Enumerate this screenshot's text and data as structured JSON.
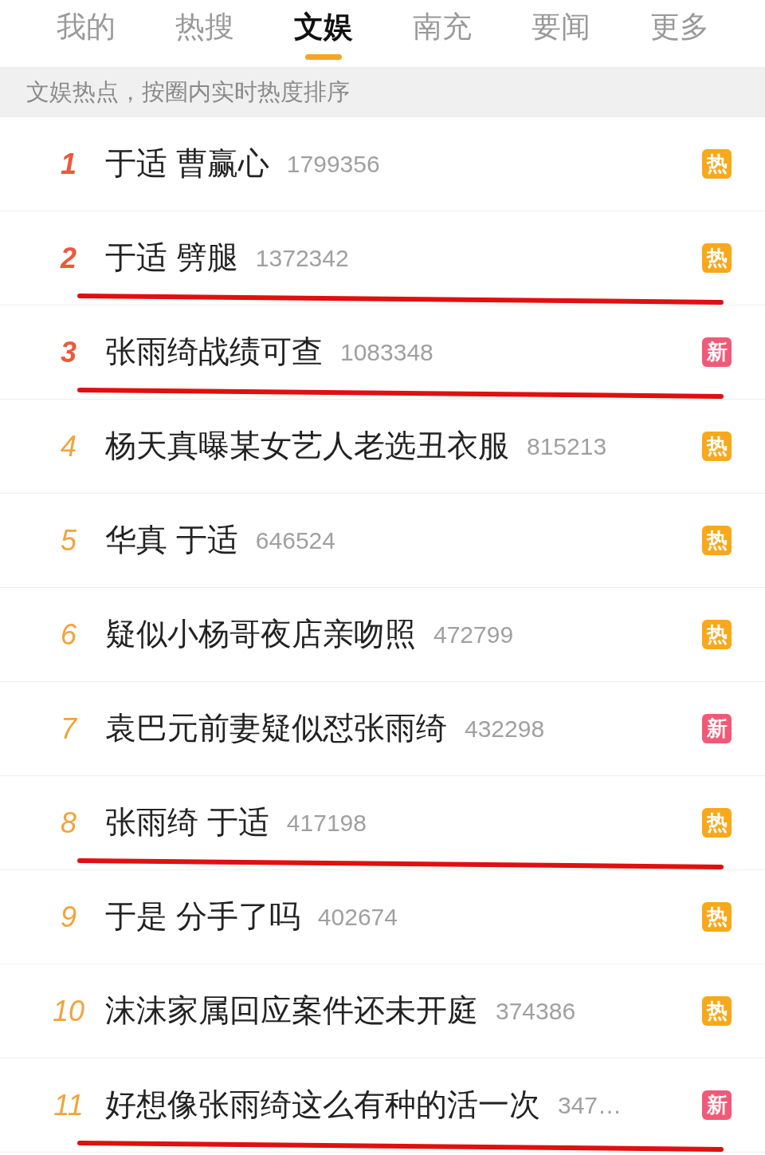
{
  "tabs": [
    {
      "label": "我的",
      "selected": false
    },
    {
      "label": "热搜",
      "selected": false
    },
    {
      "label": "文娱",
      "selected": true
    },
    {
      "label": "南充",
      "selected": false
    },
    {
      "label": "要闻",
      "selected": false
    },
    {
      "label": "更多",
      "selected": false
    }
  ],
  "subtitle": "文娱热点，按圈内实时热度排序",
  "rows": [
    {
      "rank": "1",
      "color": "#ea5a3d",
      "title": "于适 曹赢心",
      "count": "1799356",
      "badge": {
        "kind": "hot",
        "label": "热"
      },
      "underlined": false
    },
    {
      "rank": "2",
      "color": "#ea5a3d",
      "title": "于适 劈腿",
      "count": "1372342",
      "badge": {
        "kind": "hot",
        "label": "热"
      },
      "underlined": true
    },
    {
      "rank": "3",
      "color": "#ea5a3d",
      "title": "张雨绮战绩可查",
      "count": "1083348",
      "badge": {
        "kind": "new",
        "label": "新"
      },
      "underlined": true
    },
    {
      "rank": "4",
      "color": "#f2a33a",
      "title": "杨天真曝某女艺人老选丑衣服",
      "count": "815213",
      "badge": {
        "kind": "hot",
        "label": "热"
      },
      "underlined": false
    },
    {
      "rank": "5",
      "color": "#f2a33a",
      "title": "华真 于适",
      "count": "646524",
      "badge": {
        "kind": "hot",
        "label": "热"
      },
      "underlined": false
    },
    {
      "rank": "6",
      "color": "#f2a33a",
      "title": "疑似小杨哥夜店亲吻照",
      "count": "472799",
      "badge": {
        "kind": "hot",
        "label": "热"
      },
      "underlined": false
    },
    {
      "rank": "7",
      "color": "#f2a33a",
      "title": "袁巴元前妻疑似怼张雨绮",
      "count": "432298",
      "badge": {
        "kind": "new",
        "label": "新"
      },
      "underlined": false
    },
    {
      "rank": "8",
      "color": "#f2a33a",
      "title": "张雨绮 于适",
      "count": "417198",
      "badge": {
        "kind": "hot",
        "label": "热"
      },
      "underlined": true
    },
    {
      "rank": "9",
      "color": "#f2a33a",
      "title": "于是 分手了吗",
      "count": "402674",
      "badge": {
        "kind": "hot",
        "label": "热"
      },
      "underlined": false
    },
    {
      "rank": "10",
      "color": "#f2a33a",
      "title": "沫沫家属回应案件还未开庭",
      "count": "374386",
      "badge": {
        "kind": "hot",
        "label": "热"
      },
      "underlined": false
    },
    {
      "rank": "11",
      "color": "#f2a33a",
      "title": "好想像张雨绮这么有种的活一次",
      "count": "347…",
      "badge": {
        "kind": "new",
        "label": "新"
      },
      "underlined": true
    }
  ]
}
